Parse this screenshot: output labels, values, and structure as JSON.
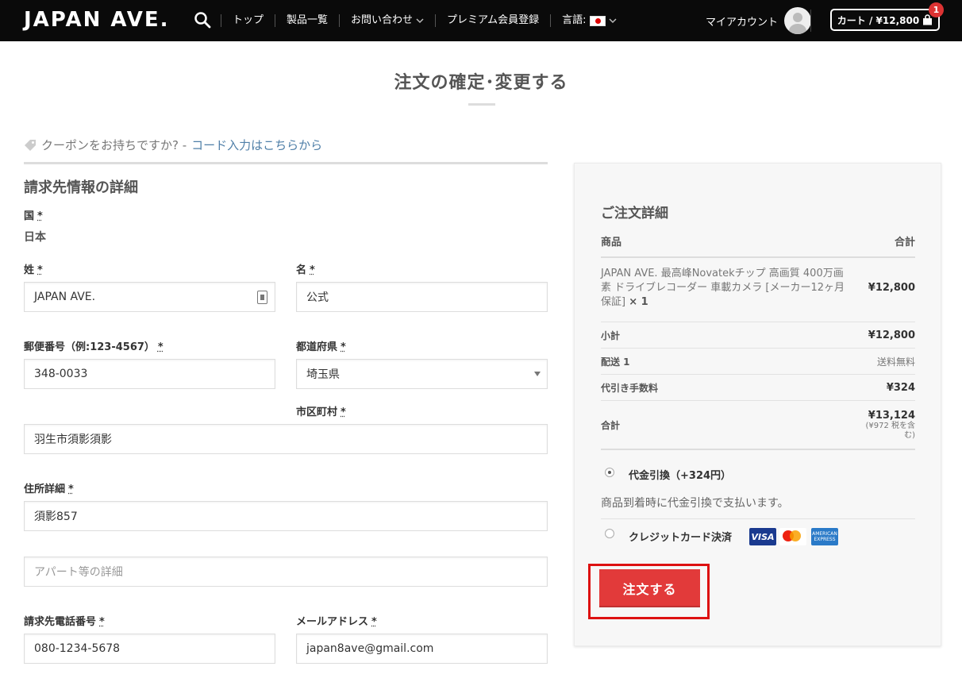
{
  "header": {
    "logo": "JAPAN AVE.",
    "nav": [
      {
        "label": "トップ"
      },
      {
        "label": "製品一覧"
      },
      {
        "label": "お問い合わせ"
      },
      {
        "label": "プレミアム会員登録"
      },
      {
        "label": "言語:"
      }
    ],
    "account_label": "マイアカウント",
    "cart_label": "カート / ¥12,800",
    "cart_count": "1"
  },
  "page": {
    "title": "注文の確定･変更する"
  },
  "coupon": {
    "text": "クーポンをお持ちですか? -",
    "link": "コード入力はこちらから"
  },
  "billing": {
    "title": "請求先情報の詳細",
    "required_mark": "*",
    "country_label": "国",
    "country_value": "日本",
    "last_name_label": "姓",
    "last_name_value": "JAPAN AVE.",
    "first_name_label": "名",
    "first_name_value": "公式",
    "postcode_label": "郵便番号（例:123-4567）",
    "postcode_value": "348-0033",
    "prefecture_label": "都道府県",
    "prefecture_value": "埼玉県",
    "city_label": "市区町村",
    "city_value": "羽生市須影須影",
    "address_label": "住所詳細",
    "address_value": "須影857",
    "address2_placeholder": "アパート等の詳細",
    "phone_label": "請求先電話番号",
    "phone_value": "080-1234-5678",
    "email_label": "メールアドレス",
    "email_value": "japan8ave@gmail.com"
  },
  "order": {
    "title": "ご注文詳細",
    "col_product": "商品",
    "col_total": "合計",
    "product_name": "JAPAN AVE. 最高峰Novatekチップ 高画質 400万画素 ドライブレコーダー 車載カメラ [メーカー12ヶ月保証]",
    "product_qty": "× 1",
    "product_price": "¥12,800",
    "subtotal_label": "小計",
    "subtotal_value": "¥12,800",
    "shipping_label": "配送 1",
    "shipping_value": "送料無料",
    "cod_fee_label": "代引き手数料",
    "cod_fee_value": "¥324",
    "total_label": "合計",
    "total_value": "¥13,124",
    "tax_note": "(¥972 税を含む)",
    "pay_cod_label": "代金引換（+324円）",
    "pay_cod_desc": "商品到着時に代金引換で支払います。",
    "pay_card_label": "クレジットカード決済",
    "visa_text": "VISA",
    "amex_text": "AMERICAN EXPRESS",
    "place_order": "注文する"
  },
  "colors": {
    "header_bg": "#0a0a0a",
    "link": "#4f7fa8",
    "order_button": "#e23a3a",
    "highlight": "#dd1111"
  }
}
